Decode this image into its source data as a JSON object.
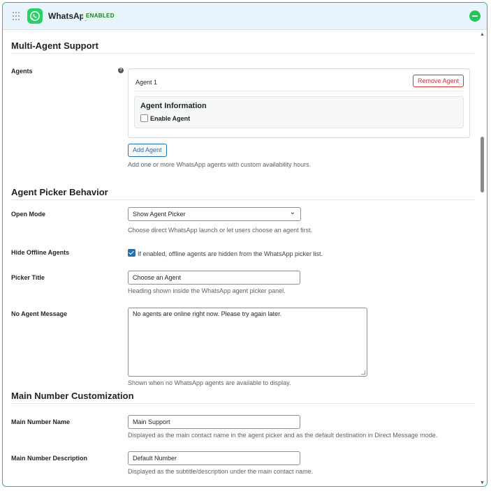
{
  "header": {
    "title": "WhatsApp",
    "badge": "ENABLED"
  },
  "sections": {
    "multi_agent": "Multi-Agent Support",
    "picker_behavior": "Agent Picker Behavior",
    "main_number": "Main Number Customization"
  },
  "agents": {
    "label": "Agents",
    "help_icon": "?",
    "card": {
      "name": "Agent 1",
      "remove_label": "Remove Agent",
      "info_title": "Agent Information",
      "enable_label": "Enable Agent",
      "enable_checked": false
    },
    "add_label": "Add Agent",
    "help": "Add one or more WhatsApp agents with custom availability hours."
  },
  "open_mode": {
    "label": "Open Mode",
    "value": "Show Agent Picker",
    "help": "Choose direct WhatsApp launch or let users choose an agent first."
  },
  "hide_offline": {
    "label": "Hide Offline Agents",
    "checked": true,
    "text": "If enabled, offline agents are hidden from the WhatsApp picker list."
  },
  "picker_title": {
    "label": "Picker Title",
    "value": "Choose an Agent",
    "help": "Heading shown inside the WhatsApp agent picker panel."
  },
  "no_agent_message": {
    "label": "No Agent Message",
    "value": "No agents are online right now. Please try again later.",
    "help": "Shown when no WhatsApp agents are available to display."
  },
  "main_number_name": {
    "label": "Main Number Name",
    "value": "Main Support",
    "help": "Displayed as the main contact name in the agent picker and as the default destination in Direct Message mode."
  },
  "main_number_description": {
    "label": "Main Number Description",
    "value": "Default Number",
    "help": "Displayed as the subtitle/description under the main contact name."
  },
  "colors": {
    "accent_green": "#25d366",
    "border_green": "#2fbf57",
    "link_blue": "#2271b1",
    "danger_red": "#d63638"
  },
  "icons": [
    "drag-handle-icon",
    "whatsapp-logo-icon",
    "collapse-minus-icon",
    "help-icon",
    "chevron-down-icon",
    "checkbox-checked-icon"
  ]
}
